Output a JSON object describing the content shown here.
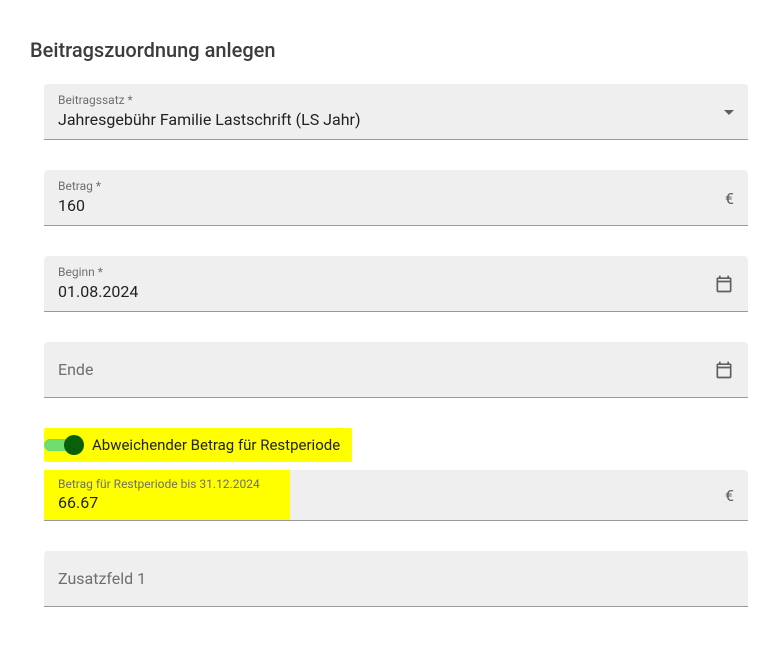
{
  "title": "Beitragszuordnung anlegen",
  "beitragssatz": {
    "label": "Beitragssatz *",
    "value": "Jahresgebühr Familie Lastschrift (LS Jahr)"
  },
  "betrag": {
    "label": "Betrag *",
    "value": "160",
    "currency": "€"
  },
  "beginn": {
    "label": "Beginn *",
    "value": "01.08.2024"
  },
  "ende": {
    "label": "Ende",
    "value": ""
  },
  "toggle": {
    "label": "Abweichender Betrag für Restperiode",
    "on": true
  },
  "restperiode": {
    "label": "Betrag für Restperiode bis 31.12.2024",
    "value": "66.67",
    "currency": "€"
  },
  "zusatz1": {
    "label": "Zusatzfeld 1",
    "value": ""
  }
}
